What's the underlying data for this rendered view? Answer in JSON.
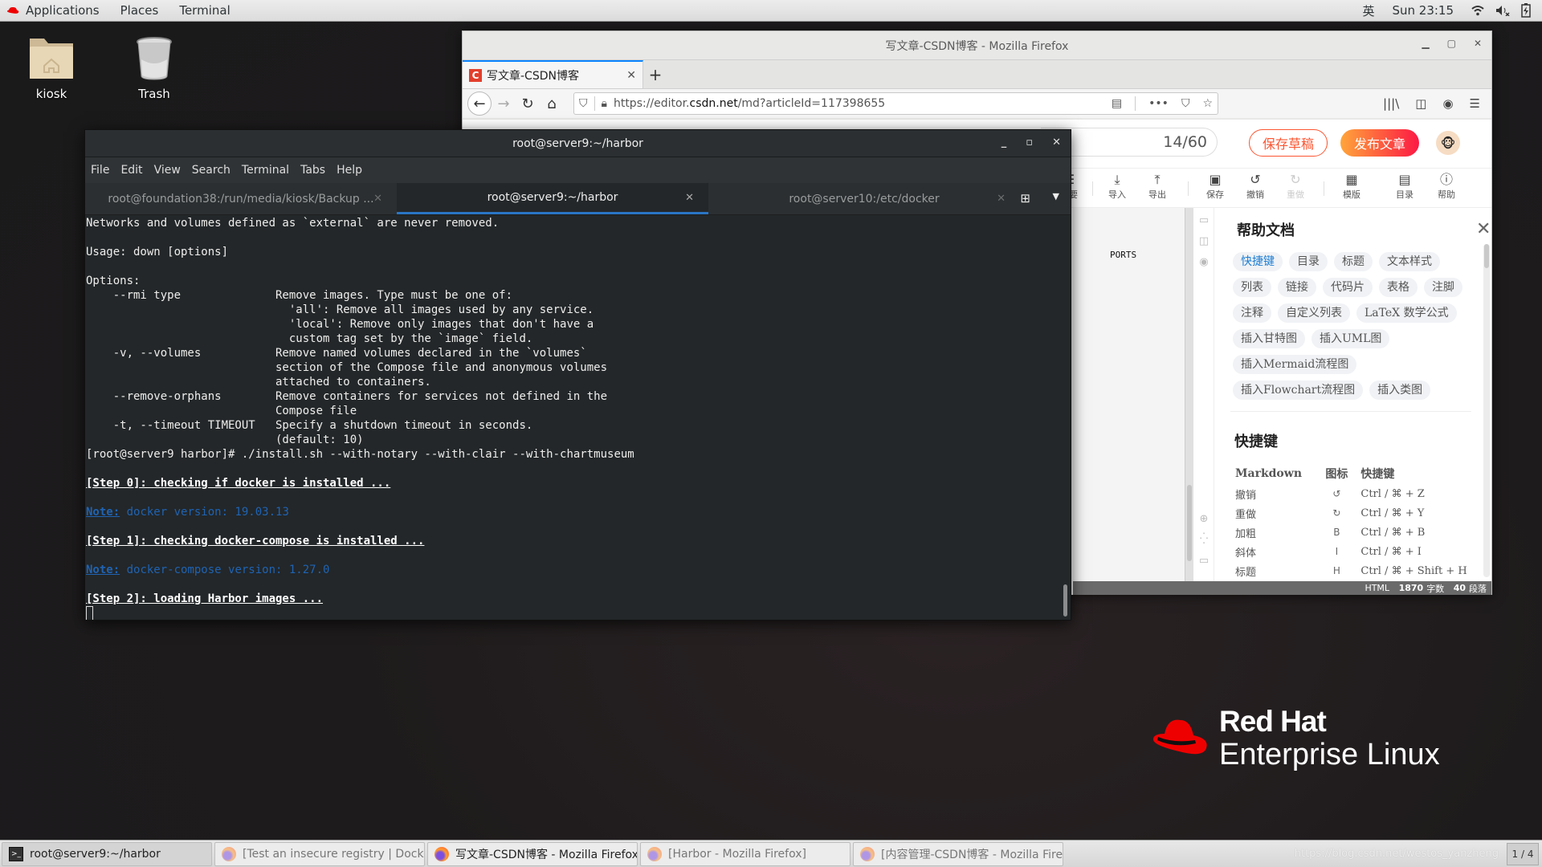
{
  "topbar": {
    "menus": [
      "Applications",
      "Places",
      "Terminal"
    ],
    "input_method": "英",
    "clock": "Sun 23:15",
    "icons": [
      "wifi-icon",
      "volume-muted-icon",
      "battery-charging-icon"
    ]
  },
  "desktop": {
    "icons": [
      {
        "label": "kiosk",
        "icon": "home-folder-icon"
      },
      {
        "label": "Trash",
        "icon": "trash-icon"
      }
    ],
    "logo": {
      "line1": "Red Hat",
      "line2": "Enterprise Linux"
    }
  },
  "firefox": {
    "window_title": "写文章-CSDN博客 - Mozilla Firefox",
    "tab": {
      "title": "写文章-CSDN博客",
      "favicon": "C"
    },
    "url": {
      "prefix": "https://editor.",
      "domain": "csdn.net",
      "path": "/md?articleId=117398655"
    },
    "editor": {
      "title_counter": "14/60",
      "save_draft": "保存草稿",
      "publish": "发布文章",
      "toolbar": [
        {
          "icon": "summary-icon",
          "label": "摘要",
          "enabled": true
        },
        {
          "icon": "import-icon",
          "label": "导入",
          "enabled": true
        },
        {
          "icon": "export-icon",
          "label": "导出",
          "enabled": true
        },
        {
          "icon": "save-icon",
          "label": "保存",
          "enabled": true
        },
        {
          "icon": "undo-icon",
          "label": "撤销",
          "enabled": true
        },
        {
          "icon": "redo-icon",
          "label": "重做",
          "enabled": false
        },
        {
          "icon": "template-icon",
          "label": "模版",
          "enabled": true
        },
        {
          "icon": "toc-icon",
          "label": "目录",
          "enabled": true
        },
        {
          "icon": "help-icon",
          "label": "帮助",
          "enabled": true
        }
      ],
      "preview_text": "PORTS",
      "help": {
        "title": "帮助文档",
        "tags": [
          "快捷键",
          "目录",
          "标题",
          "文本样式",
          "列表",
          "链接",
          "代码片",
          "表格",
          "注脚",
          "注释",
          "自定义列表",
          "LaTeX 数学公式",
          "插入甘特图",
          "插入UML图",
          "插入Mermaid流程图",
          "插入Flowchart流程图",
          "插入类图"
        ],
        "active_tag": "快捷键",
        "shortcuts_title": "快捷键",
        "columns": [
          "Markdown",
          "图标",
          "快捷键"
        ],
        "rows": [
          {
            "name": "撤销",
            "icon": "↺",
            "key": "Ctrl / ⌘ + Z"
          },
          {
            "name": "重做",
            "icon": "↻",
            "key": "Ctrl / ⌘ + Y"
          },
          {
            "name": "加粗",
            "icon": "B",
            "key": "Ctrl / ⌘ + B"
          },
          {
            "name": "斜体",
            "icon": "I",
            "key": "Ctrl / ⌘ + I"
          },
          {
            "name": "标题",
            "icon": "H",
            "key": "Ctrl / ⌘ + Shift + H"
          }
        ]
      },
      "status": {
        "mode": "HTML",
        "chars": "1870",
        "chars_label": "字数",
        "paras": "40",
        "paras_label": "段落"
      }
    }
  },
  "terminal": {
    "window_title": "root@server9:~/harbor",
    "menu": [
      "File",
      "Edit",
      "View",
      "Search",
      "Terminal",
      "Tabs",
      "Help"
    ],
    "tabs": [
      {
        "title": "root@foundation38:/run/media/kiosk/Backup ...",
        "active": false
      },
      {
        "title": "root@server9:~/harbor",
        "active": true
      },
      {
        "title": "root@server10:/etc/docker",
        "active": false
      }
    ],
    "lines": [
      {
        "t": "text",
        "s": "Networks and volumes defined as `external` are never removed."
      },
      {
        "t": "text",
        "s": ""
      },
      {
        "t": "text",
        "s": "Usage: down [options]"
      },
      {
        "t": "text",
        "s": ""
      },
      {
        "t": "text",
        "s": "Options:"
      },
      {
        "t": "text",
        "s": "    --rmi type              Remove images. Type must be one of:"
      },
      {
        "t": "text",
        "s": "                              'all': Remove all images used by any service."
      },
      {
        "t": "text",
        "s": "                              'local': Remove only images that don't have a"
      },
      {
        "t": "text",
        "s": "                              custom tag set by the `image` field."
      },
      {
        "t": "text",
        "s": "    -v, --volumes           Remove named volumes declared in the `volumes`"
      },
      {
        "t": "text",
        "s": "                            section of the Compose file and anonymous volumes"
      },
      {
        "t": "text",
        "s": "                            attached to containers."
      },
      {
        "t": "text",
        "s": "    --remove-orphans        Remove containers for services not defined in the"
      },
      {
        "t": "text",
        "s": "                            Compose file"
      },
      {
        "t": "text",
        "s": "    -t, --timeout TIMEOUT   Specify a shutdown timeout in seconds."
      },
      {
        "t": "text",
        "s": "                            (default: 10)"
      },
      {
        "t": "text",
        "s": "[root@server9 harbor]# ./install.sh --with-notary --with-clair --with-chartmuseum"
      },
      {
        "t": "text",
        "s": ""
      },
      {
        "t": "step",
        "s": "[Step 0]: checking if docker is installed ..."
      },
      {
        "t": "text",
        "s": ""
      },
      {
        "t": "note",
        "label": "Note:",
        "s": " docker version: 19.03.13"
      },
      {
        "t": "text",
        "s": ""
      },
      {
        "t": "step",
        "s": "[Step 1]: checking docker-compose is installed ..."
      },
      {
        "t": "text",
        "s": ""
      },
      {
        "t": "note",
        "label": "Note:",
        "s": " docker-compose version: 1.27.0"
      },
      {
        "t": "text",
        "s": ""
      },
      {
        "t": "step",
        "s": "[Step 2]: loading Harbor images ..."
      },
      {
        "t": "cursor",
        "s": ""
      }
    ]
  },
  "taskbar": {
    "tasks": [
      {
        "label": "root@server9:~/harbor",
        "icon": "terminal-icon",
        "state": "active"
      },
      {
        "label": "[Test an insecure registry | Docker ...",
        "icon": "firefox-icon",
        "state": "minimized"
      },
      {
        "label": "写文章-CSDN博客 - Mozilla Firefox",
        "icon": "firefox-icon",
        "state": "normal"
      },
      {
        "label": "[Harbor - Mozilla Firefox]",
        "icon": "firefox-icon",
        "state": "minimized"
      },
      {
        "label": "[内容管理-CSDN博客 - Mozilla Firef...",
        "icon": "firefox-icon",
        "state": "minimized"
      }
    ],
    "watermark": "https://blog.csdn.net/westos_yanzheng",
    "workspace": "1 / 4"
  }
}
